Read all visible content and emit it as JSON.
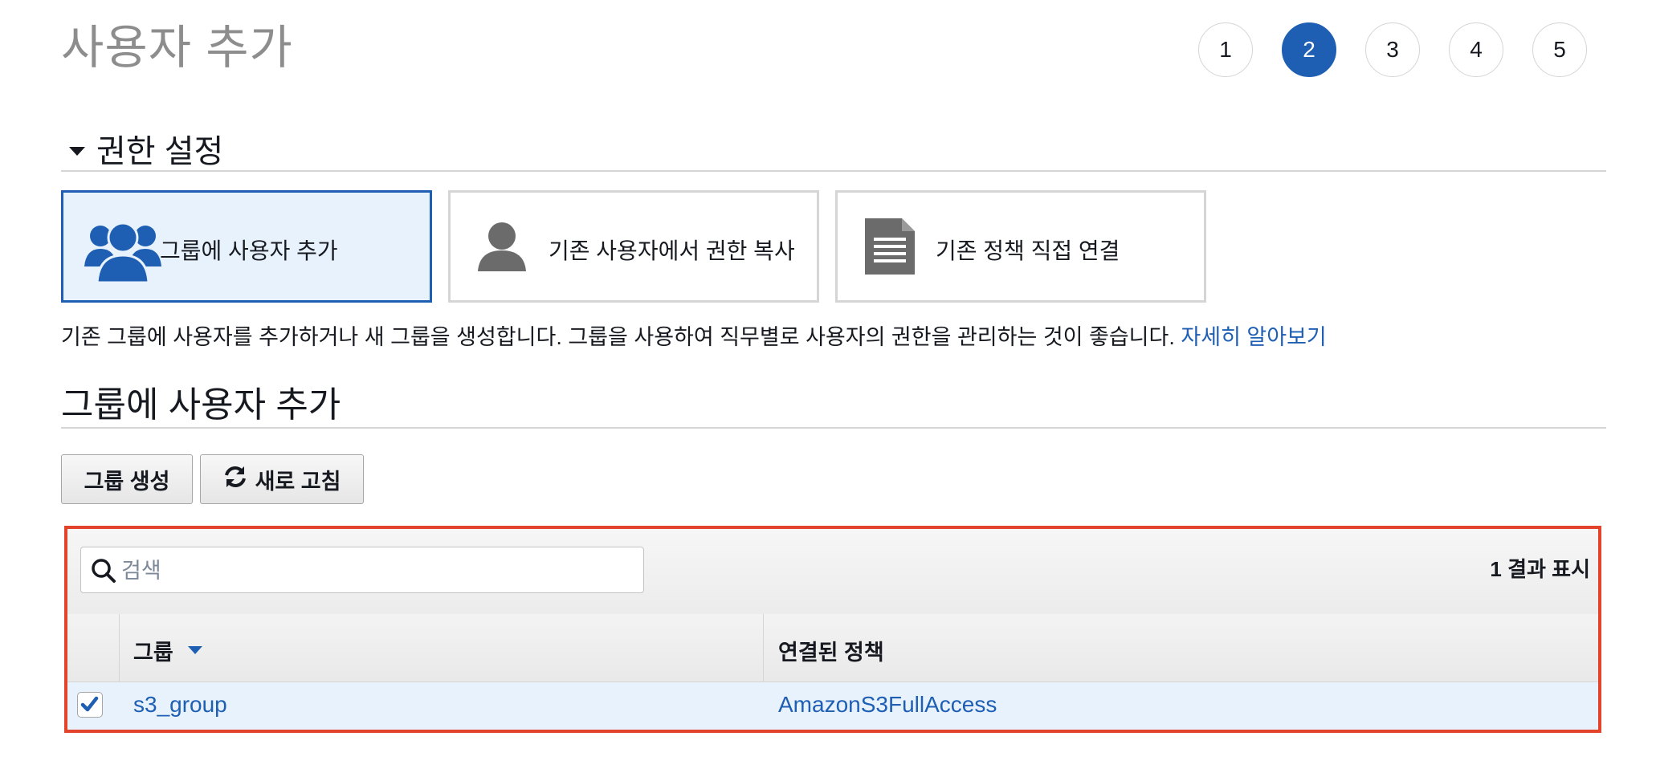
{
  "page": {
    "title": "사용자 추가"
  },
  "steps": [
    {
      "label": "1",
      "active": false
    },
    {
      "label": "2",
      "active": true
    },
    {
      "label": "3",
      "active": false
    },
    {
      "label": "4",
      "active": false
    },
    {
      "label": "5",
      "active": false
    }
  ],
  "permissions": {
    "section_title": "권한 설정",
    "options": [
      {
        "label": "그룹에 사용자 추가",
        "icon": "users-group-icon",
        "selected": true
      },
      {
        "label": "기존 사용자에서 권한 복사",
        "icon": "user-icon",
        "selected": false
      },
      {
        "label": "기존 정책 직접 연결",
        "icon": "document-icon",
        "selected": false
      }
    ],
    "description": "기존 그룹에 사용자를 추가하거나 새 그룹을 생성합니다. 그룹을 사용하여 직무별로 사용자의 권한을 관리하는 것이 좋습니다.",
    "learn_more": "자세히 알아보기"
  },
  "group_section": {
    "title": "그룹에 사용자 추가",
    "create_button": "그룹 생성",
    "refresh_button": "새로 고침"
  },
  "table": {
    "search_placeholder": "검색",
    "result_count": "1 결과 표시",
    "columns": [
      "그룹",
      "연결된 정책"
    ],
    "rows": [
      {
        "checked": true,
        "group": "s3_group",
        "policy": "AmazonS3FullAccess"
      }
    ]
  },
  "colors": {
    "accent": "#1f5fb3",
    "selected_bg": "#e8f2fd",
    "highlight_border": "#e2432a",
    "title_gray": "#8d8d8d"
  }
}
